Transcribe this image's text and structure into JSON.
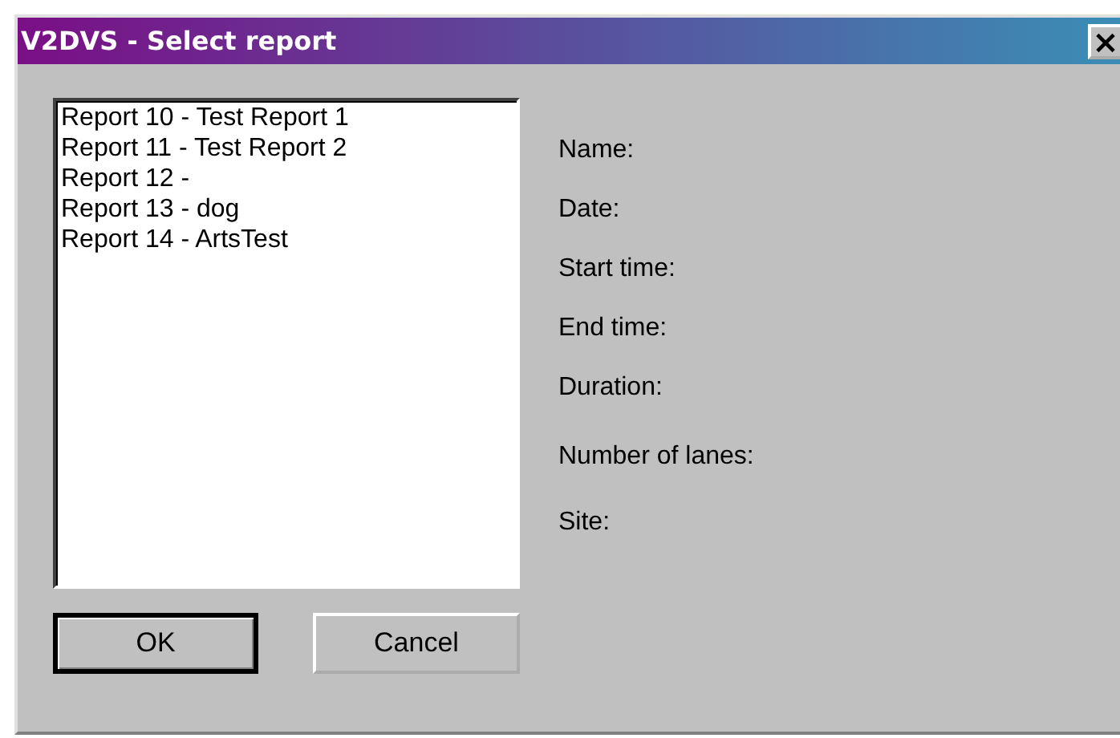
{
  "window": {
    "title": "V2DVS - Select report",
    "close": "×"
  },
  "reports": [
    {
      "label": "Report 10 - Test Report 1",
      "selected": false
    },
    {
      "label": "Report 11 - Test Report 2",
      "selected": false
    },
    {
      "label": "Report 12 -",
      "selected": false
    },
    {
      "label": "Report 13 - dog",
      "selected": false
    },
    {
      "label": "Report 14 - ArtsTest",
      "selected": false
    }
  ],
  "buttons": [
    {
      "label": "OK",
      "default": true
    },
    {
      "label": "Cancel",
      "default": false
    }
  ],
  "details": [
    "Name:",
    "Date:",
    "Start time:",
    "End time:",
    "Duration:",
    "Number of lanes:",
    "Site:"
  ]
}
